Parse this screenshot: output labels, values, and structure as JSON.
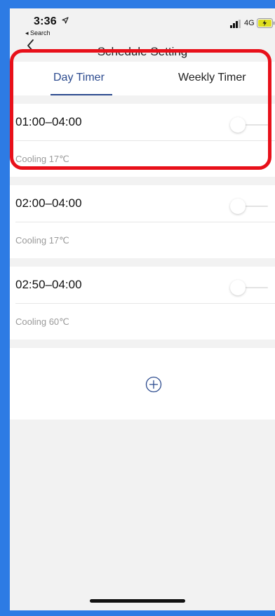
{
  "status_bar": {
    "time": "3:36",
    "back_app": "◂ Search",
    "network": "4G"
  },
  "nav": {
    "title": "Schedule Setting"
  },
  "tabs": [
    {
      "label": "Day Timer",
      "selected": true
    },
    {
      "label": "Weekly Timer",
      "selected": false
    }
  ],
  "schedules": [
    {
      "time_range": "01:00–04:00",
      "mode": "Cooling 17℃",
      "enabled": false
    },
    {
      "time_range": "02:00–04:00",
      "mode": "Cooling 17℃",
      "enabled": false
    },
    {
      "time_range": "02:50–04:00",
      "mode": "Cooling 60℃",
      "enabled": false
    }
  ],
  "colors": {
    "accent": "#2b4a8e",
    "highlight": "#e8101a",
    "frame": "#2d7be4"
  },
  "icons": {
    "back": "chevron-left-icon",
    "add": "plus-circle-icon",
    "location": "location-arrow-icon",
    "signal": "signal-bars-icon",
    "battery": "battery-charging-icon"
  }
}
